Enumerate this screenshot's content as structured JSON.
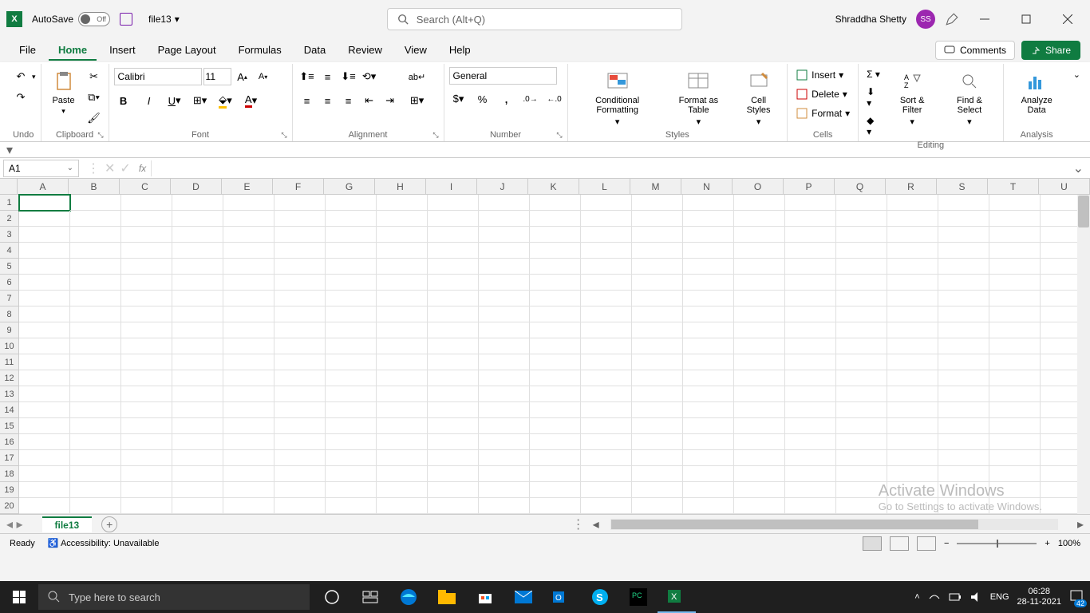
{
  "titlebar": {
    "autosave_label": "AutoSave",
    "autosave_state": "Off",
    "filename": "file13",
    "search_placeholder": "Search (Alt+Q)",
    "username": "Shraddha Shetty",
    "avatar_initials": "SS"
  },
  "tabs": {
    "items": [
      "File",
      "Home",
      "Insert",
      "Page Layout",
      "Formulas",
      "Data",
      "Review",
      "View",
      "Help"
    ],
    "active": "Home",
    "comments": "Comments",
    "share": "Share"
  },
  "ribbon": {
    "undo": {
      "label": "Undo"
    },
    "clipboard": {
      "paste": "Paste",
      "label": "Clipboard"
    },
    "font": {
      "label": "Font",
      "name": "Calibri",
      "size": "11"
    },
    "alignment": {
      "label": "Alignment"
    },
    "number": {
      "label": "Number",
      "format": "General"
    },
    "styles": {
      "label": "Styles",
      "conditional": "Conditional Formatting",
      "table": "Format as Table",
      "cell": "Cell Styles"
    },
    "cells": {
      "label": "Cells",
      "insert": "Insert",
      "delete": "Delete",
      "format": "Format"
    },
    "editing": {
      "label": "Editing",
      "sortfilter": "Sort & Filter",
      "findselect": "Find & Select"
    },
    "analysis": {
      "label": "Analysis",
      "analyze": "Analyze Data"
    }
  },
  "formula": {
    "namebox": "A1",
    "fx": "fx",
    "value": ""
  },
  "grid": {
    "columns": [
      "A",
      "B",
      "C",
      "D",
      "E",
      "F",
      "G",
      "H",
      "I",
      "J",
      "K",
      "L",
      "M",
      "N",
      "O",
      "P",
      "Q",
      "R",
      "S",
      "T",
      "U"
    ],
    "rows": 20,
    "selected_cell": "A1"
  },
  "watermark": {
    "title": "Activate Windows",
    "subtitle": "Go to Settings to activate Windows."
  },
  "sheets": {
    "active": "file13"
  },
  "status": {
    "ready": "Ready",
    "accessibility": "Accessibility: Unavailable",
    "zoom": "100%"
  },
  "taskbar": {
    "search_placeholder": "Type here to search",
    "lang": "ENG",
    "time": "06:28",
    "date": "28-11-2021",
    "notif_count": "42"
  }
}
